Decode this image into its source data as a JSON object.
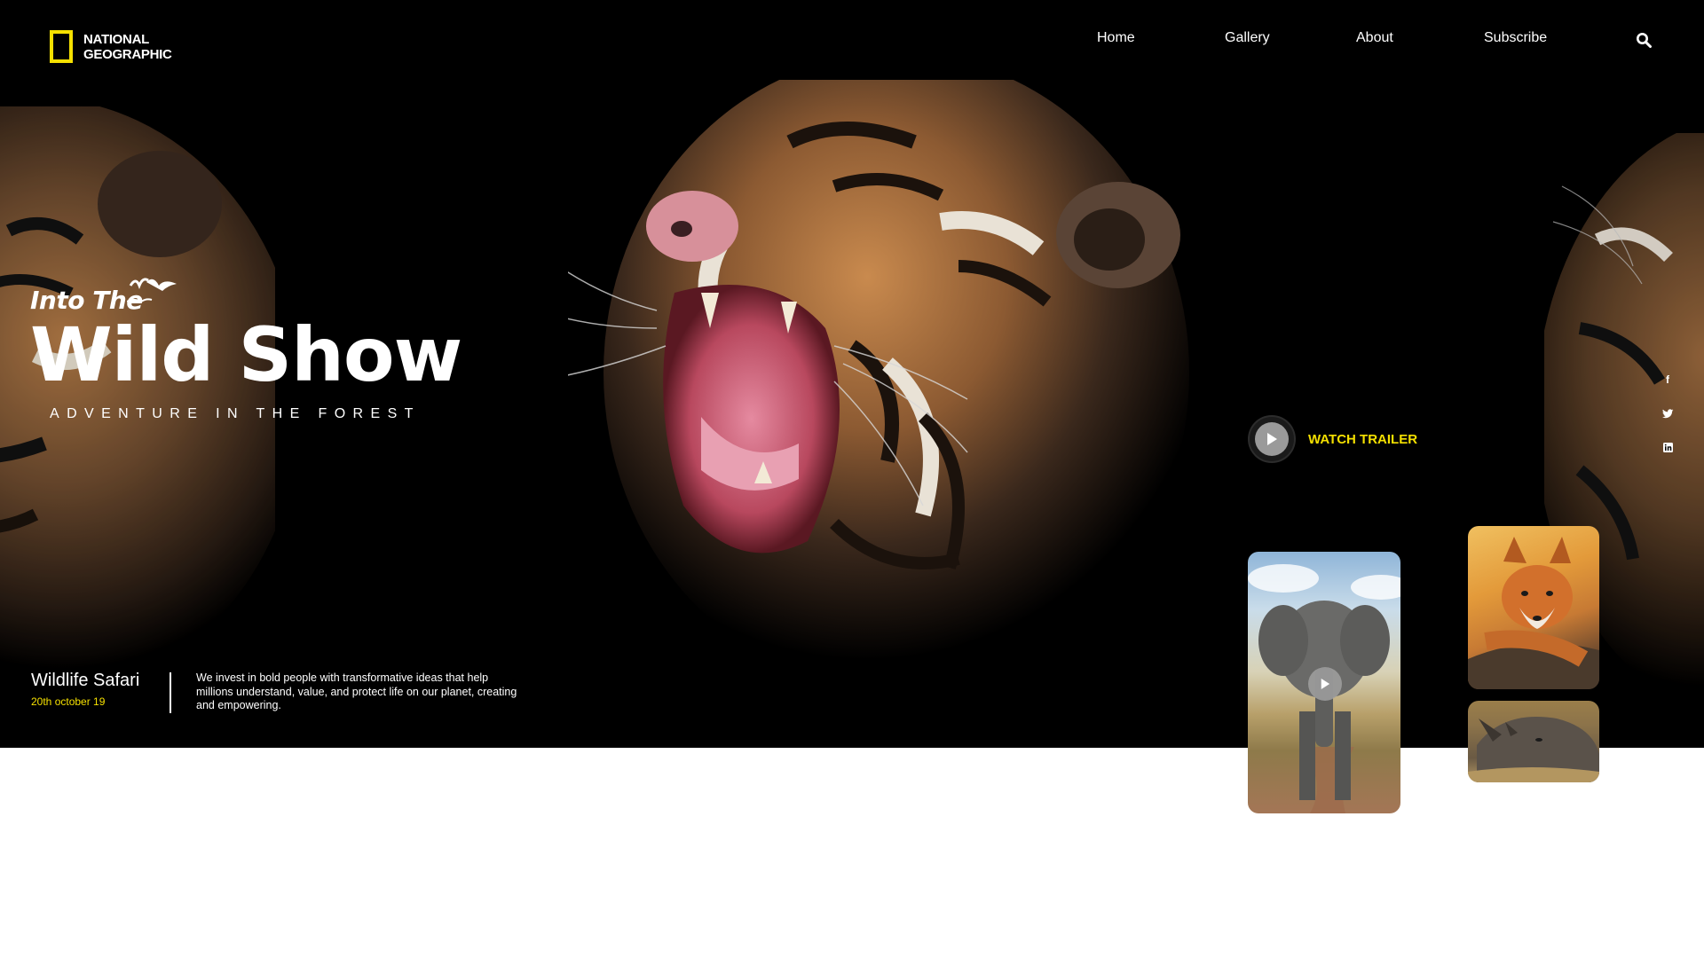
{
  "brand": {
    "logo_line1": "NATIONAL",
    "logo_line2": "GEOGRAPHIC",
    "accent_color": "#f5e000"
  },
  "nav": {
    "items": [
      {
        "label": "Home"
      },
      {
        "label": "Gallery"
      },
      {
        "label": "About"
      },
      {
        "label": "Subscribe"
      }
    ],
    "search_icon": "search-icon"
  },
  "hero": {
    "pre_title": "Into The",
    "title": "Wild Show",
    "subtitle": "ADVENTURE IN THE FOREST",
    "background_color": "#000000"
  },
  "trailer": {
    "label": "WATCH TRAILER",
    "icon": "play-icon"
  },
  "social": {
    "icons": [
      "facebook-icon",
      "twitter-icon",
      "linkedin-icon"
    ],
    "glyphs": [
      "f",
      "t",
      "in"
    ]
  },
  "event": {
    "title": "Wildlife Safari",
    "date": "20th october 19",
    "description": "We invest in bold people with transformative ideas that help millions understand, value, and protect life on our planet, creating and empowering."
  },
  "gallery": {
    "cards": [
      {
        "name": "elephant",
        "has_play": true
      },
      {
        "name": "fox",
        "has_play": false
      },
      {
        "name": "rhino",
        "has_play": false
      }
    ]
  }
}
